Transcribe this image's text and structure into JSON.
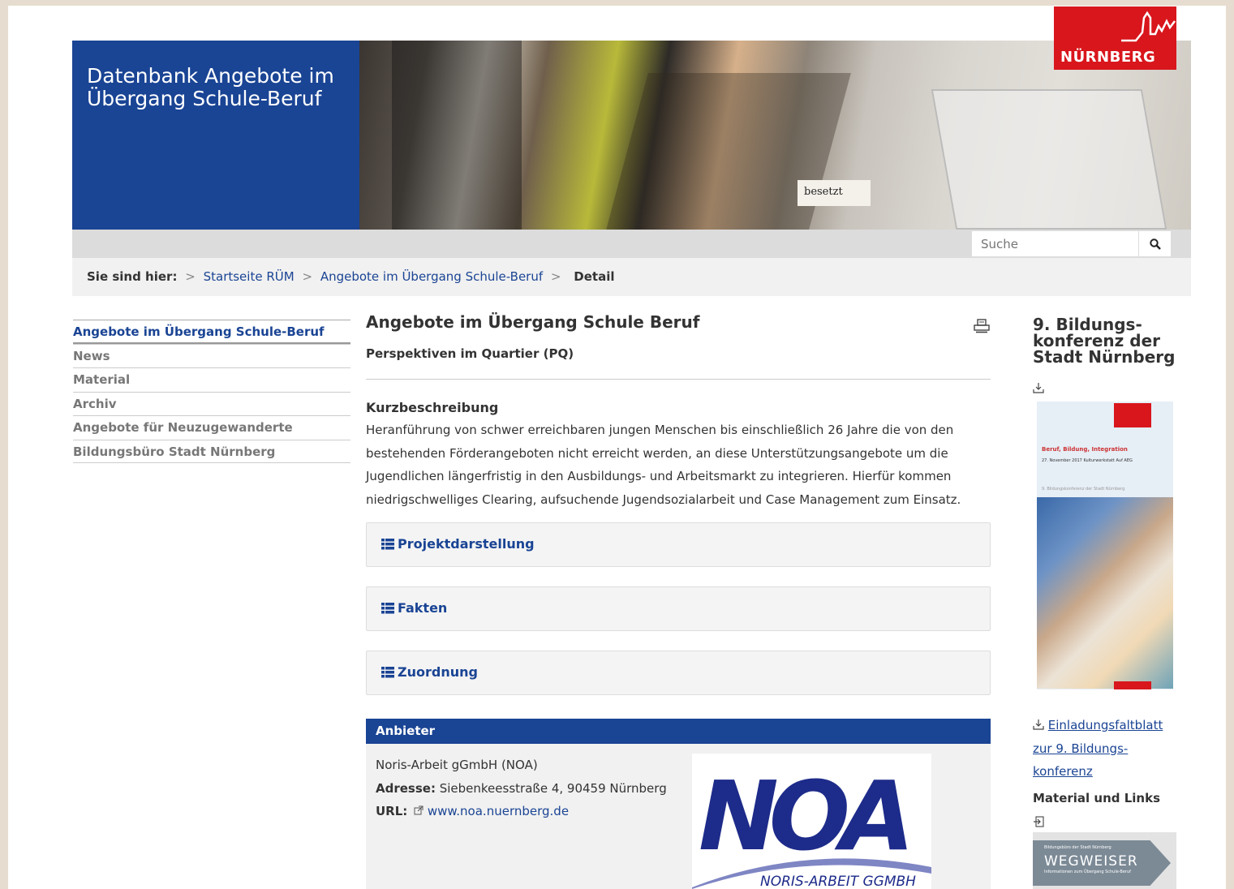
{
  "header": {
    "title_line1": "Datenbank Angebote im",
    "title_line2": "Übergang Schule-Beruf",
    "logo_text": "NÜRNBERG",
    "photo_sign": "besetzt"
  },
  "search": {
    "placeholder": "Suche"
  },
  "breadcrumb": {
    "label": "Sie sind hier:",
    "sep": ">",
    "items": [
      "Startseite RÜM",
      "Angebote im Übergang Schule-Beruf"
    ],
    "current": "Detail"
  },
  "leftnav": {
    "items": [
      {
        "label": "Angebote im Übergang Schule-Beruf"
      },
      {
        "label": "News"
      },
      {
        "label": "Material"
      },
      {
        "label": "Archiv"
      },
      {
        "label": "Angebote für Neuzugewanderte"
      },
      {
        "label": "Bildungsbüro Stadt Nürnberg"
      }
    ]
  },
  "main": {
    "title": "Angebote im Übergang Schule Beruf",
    "subtitle": "Perspektiven im Quartier (PQ)",
    "kurz_heading": "Kurzbeschreibung",
    "kurz_text": "Heranführung von schwer erreichbaren jungen Menschen bis einschließlich 26 Jahre die von den bestehenden Förderangeboten nicht erreicht werden, an diese Unterstützungsangebote um die Jugendlichen längerfristig in den Ausbildungs- und Arbeitsmarkt zu integrieren. Hierfür kommen niedrigschwelliges Clearing, aufsuchende Jugendsozialarbeit und Case Management zum Einsatz.",
    "accordions": [
      "Projektdarstellung",
      "Fakten",
      "Zuordnung"
    ]
  },
  "anbieter": {
    "heading": "Anbieter",
    "name": "Noris-Arbeit gGmbH (NOA)",
    "adresse_label": "Adresse:",
    "adresse": "Siebenkeesstraße 4, 90459 Nürnberg",
    "url_label": "URL:",
    "url": "www.noa.nuernberg.de",
    "logo_big": "NOA",
    "logo_sub": "NORIS-ARBEIT GGMBH"
  },
  "right": {
    "heading_line1": "9. Bildungs-",
    "heading_line2": "konferenz der",
    "heading_line3": "Stadt Nürnberg",
    "flyer_title": "Beruf, Bildung, Integration",
    "flyer_date": "27. November 2017   Kulturwerkstatt Auf AEG",
    "flyer_sub": "9. Bildungskonferenz der Stadt Nürnberg",
    "link_text": "Einladungsfaltblatt zur 9. Bildungs-konferenz",
    "material_heading": "Material und Links",
    "wegweiser": "WEGWEISER",
    "wegweiser_top": "Bildungsbüro der Stadt Nürnberg",
    "wegweiser_sub": "Informationen zum Übergang Schule-Beruf"
  },
  "colors": {
    "brand_blue": "#1a4494",
    "brand_red": "#d8161c"
  }
}
